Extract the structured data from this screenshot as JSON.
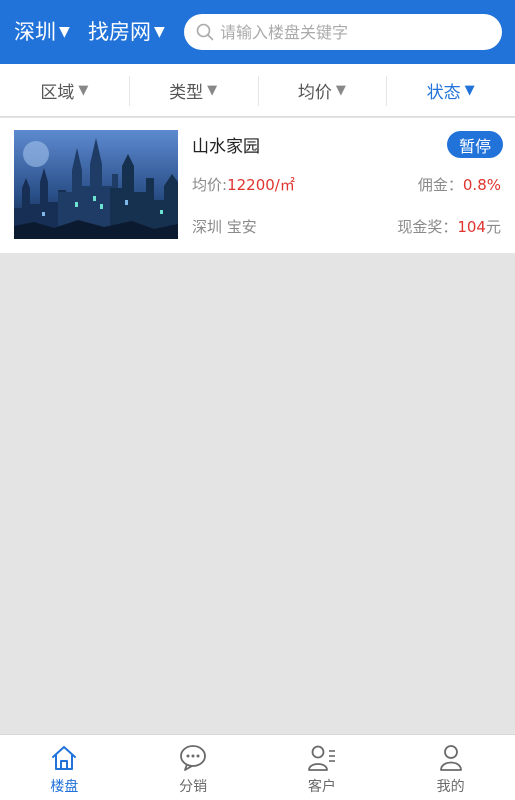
{
  "header": {
    "city": "深圳",
    "site": "找房网",
    "search_placeholder": "请输入楼盘关键字",
    "search_icon": "search-icon",
    "dropdown_icon": "triangle-down-icon"
  },
  "filters": [
    {
      "label": "区域",
      "active": false
    },
    {
      "label": "类型",
      "active": false
    },
    {
      "label": "均价",
      "active": false
    },
    {
      "label": "状态",
      "active": true
    }
  ],
  "listing": {
    "name": "山水家园",
    "status": "暂停",
    "price_label": "均价:",
    "price_value": "12200/㎡",
    "commission_label": "佣金：",
    "commission_value": "0.8%",
    "location": "深圳 宝安",
    "cash_label": "现金奖：",
    "cash_value": "104",
    "cash_unit": "元"
  },
  "tabbar": [
    {
      "label": "楼盘",
      "icon": "home-icon",
      "active": true
    },
    {
      "label": "分销",
      "icon": "chat-bubble-icon",
      "active": false
    },
    {
      "label": "客户",
      "icon": "customer-list-icon",
      "active": false
    },
    {
      "label": "我的",
      "icon": "person-icon",
      "active": false
    }
  ],
  "colors": {
    "accent": "#2173d9",
    "highlight": "#e0342f",
    "background": "#e4e4e4"
  }
}
